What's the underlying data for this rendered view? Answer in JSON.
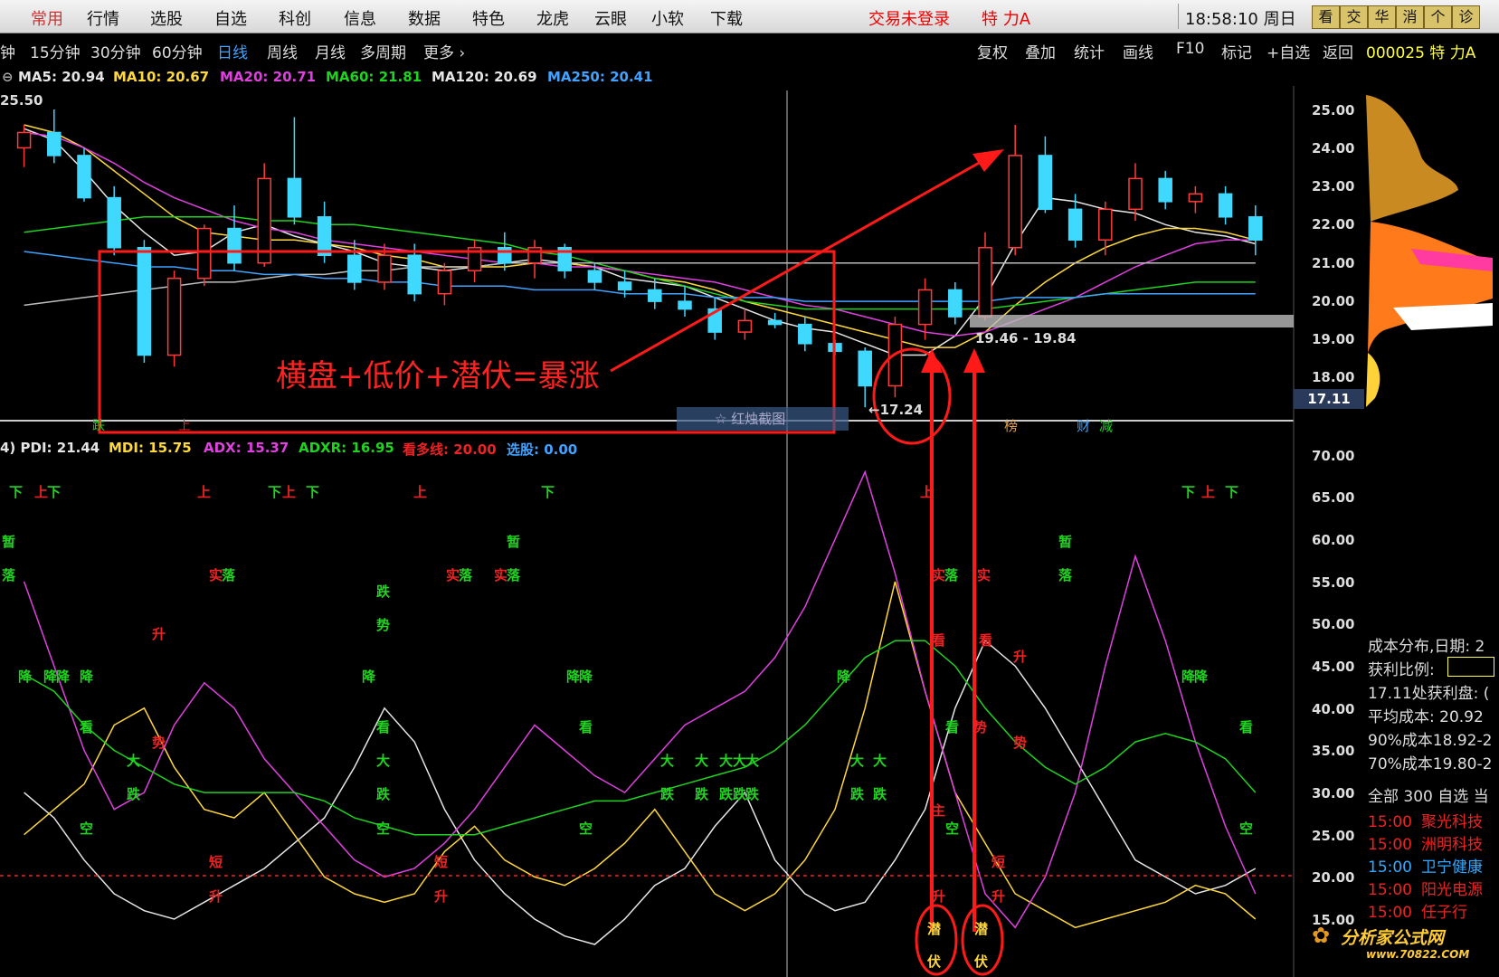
{
  "menu": {
    "items": [
      "常用",
      "行情",
      "选股",
      "自选",
      "科创",
      "信息",
      "数据",
      "特色",
      "龙虎",
      "云眼",
      "小软",
      "下载"
    ],
    "login_status": "交易未登录",
    "stock_name": "特 力A",
    "clock": "18:58:10",
    "weekday": "周日",
    "right_buttons": [
      "看",
      "交",
      "华",
      "消",
      "个",
      "诊"
    ]
  },
  "periods": {
    "items": [
      "钟",
      "15分钟",
      "30分钟",
      "60分钟",
      "日线",
      "周线",
      "月线",
      "多周期",
      "更多"
    ],
    "active": "日线"
  },
  "tools": {
    "items": [
      "复权",
      "叠加",
      "统计",
      "画线",
      "F10",
      "标记",
      "+自选",
      "返回"
    ],
    "stock_label": "000025 特 力A"
  },
  "ma_legend": [
    {
      "label": "MA5: 20.94",
      "color": "#e6e6e6"
    },
    {
      "label": "MA10: 20.67",
      "color": "#ffd83a"
    },
    {
      "label": "MA20: 20.71",
      "color": "#e040e0"
    },
    {
      "label": "MA60: 21.81",
      "color": "#1fd41f"
    },
    {
      "label": "MA120: 20.69",
      "color": "#e6e6e6"
    },
    {
      "label": "MA250: 20.41",
      "color": "#3fa3ff"
    }
  ],
  "price_axis": {
    "top_label": "25.50",
    "ticks": [
      "25.00",
      "24.00",
      "23.00",
      "22.00",
      "21.00",
      "20.00",
      "19.00",
      "18.00"
    ],
    "current": "17.11"
  },
  "chart_annot": {
    "slogan": "横盘+低价+潜伏=暴涨",
    "range_label": "19.46 - 19.84",
    "low_label": "←17.24",
    "watermark": "☆ 红烛截图",
    "event_tags": [
      "跌",
      "上",
      "榜",
      "财",
      "减"
    ]
  },
  "indicator": {
    "legend": [
      {
        "label": "4) PDI: 21.44",
        "color": "#e6e6e6"
      },
      {
        "label": "MDI: 15.75",
        "color": "#ffd83a"
      },
      {
        "label": "ADX: 15.37",
        "color": "#e040e0"
      },
      {
        "label": "ADXR: 16.95",
        "color": "#1fd41f"
      },
      {
        "label": "看多线: 20.00",
        "color": "#ee2222"
      },
      {
        "label": "选股: 0.00",
        "color": "#3fa3ff"
      }
    ],
    "ticks": [
      "70.00",
      "65.00",
      "60.00",
      "55.00",
      "50.00",
      "45.00",
      "40.00",
      "35.00",
      "30.00",
      "25.00",
      "20.00",
      "15.00"
    ],
    "signal_chars": [
      "下",
      "上",
      "暂",
      "落",
      "实",
      "跌",
      "势",
      "降",
      "升",
      "看",
      "大",
      "短",
      "空",
      "主",
      "伏",
      "潜"
    ],
    "latent_1": [
      "潜",
      "伏"
    ],
    "latent_2": [
      "潜",
      "伏"
    ]
  },
  "right_panel": {
    "chips_header": "成本分布,日期: 2",
    "profit_ratio": "获利比例:",
    "profit_at": "17.11处获利盘: (",
    "avg_cost": "平均成本: 20.92",
    "cost90": "90%成本18.92-2",
    "cost70": "70%成本19.80-2",
    "tab_line": "全部 300 自选 当",
    "news": [
      {
        "time": "15:00",
        "name": "聚光科技",
        "blue": false
      },
      {
        "time": "15:00",
        "name": "洲明科技",
        "blue": false
      },
      {
        "time": "15:00",
        "name": "卫宁健康",
        "blue": true
      },
      {
        "time": "15:00",
        "name": "阳光电源",
        "blue": false
      },
      {
        "time": "15:00",
        "name": "任子行",
        "blue": false
      }
    ],
    "logo": "分析家公式网",
    "logo_url": "www.70822.COM"
  },
  "chart_data": {
    "type": "candlestick",
    "series": [
      {
        "name": "MA5",
        "values": [
          24.5,
          24.2,
          23.4,
          22.5,
          21.8,
          21.2,
          21.3,
          21.8,
          22.0,
          21.7,
          21.5,
          21.3,
          21.0,
          20.9,
          20.8,
          20.9,
          21.0,
          21.1,
          21.0,
          20.9,
          20.6,
          20.5,
          20.4,
          20.1,
          19.8,
          19.5,
          19.3,
          19.2,
          18.9,
          18.6,
          18.6,
          19.1,
          20.1,
          21.5,
          22.7,
          22.6,
          22.4,
          22.3,
          22.0,
          21.8,
          21.7,
          21.5
        ]
      },
      {
        "name": "MA10",
        "values": [
          24.6,
          24.4,
          24.0,
          23.4,
          22.8,
          22.2,
          21.8,
          21.7,
          21.6,
          21.6,
          21.5,
          21.4,
          21.2,
          21.1,
          20.9,
          20.9,
          20.9,
          21.0,
          21.0,
          20.9,
          20.8,
          20.6,
          20.5,
          20.3,
          20.0,
          19.8,
          19.6,
          19.4,
          19.2,
          19.0,
          18.8,
          18.8,
          19.2,
          19.9,
          20.5,
          21.0,
          21.4,
          21.7,
          21.9,
          21.9,
          21.8,
          21.6
        ]
      },
      {
        "name": "MA20",
        "values": [
          24.4,
          24.3,
          24.0,
          23.6,
          23.1,
          22.7,
          22.4,
          22.1,
          21.9,
          21.8,
          21.6,
          21.5,
          21.4,
          21.3,
          21.2,
          21.1,
          21.0,
          21.0,
          20.9,
          20.9,
          20.8,
          20.7,
          20.6,
          20.5,
          20.3,
          20.1,
          19.9,
          19.8,
          19.6,
          19.4,
          19.2,
          19.1,
          19.2,
          19.5,
          19.8,
          20.1,
          20.5,
          20.9,
          21.2,
          21.5,
          21.6,
          21.6
        ]
      },
      {
        "name": "MA60",
        "values": [
          21.8,
          21.9,
          22.0,
          22.1,
          22.2,
          22.2,
          22.2,
          22.2,
          22.1,
          22.1,
          22.0,
          22.0,
          21.9,
          21.8,
          21.7,
          21.6,
          21.5,
          21.3,
          21.2,
          21.0,
          20.8,
          20.6,
          20.4,
          20.2,
          20.0,
          19.9,
          19.8,
          19.8,
          19.8,
          19.8,
          19.8,
          19.8,
          19.8,
          19.9,
          20.0,
          20.1,
          20.2,
          20.3,
          20.4,
          20.5,
          20.5,
          20.5
        ]
      },
      {
        "name": "MA120",
        "values": [
          19.9,
          20.0,
          20.1,
          20.2,
          20.3,
          20.4,
          20.5,
          20.5,
          20.6,
          20.7,
          20.7,
          20.8,
          20.8,
          20.9,
          20.9,
          20.9,
          21.0,
          21.0,
          21.0,
          21.0,
          21.0,
          21.0,
          21.0,
          21.0,
          21.0,
          21.0,
          21.0,
          21.0,
          21.0,
          21.0,
          21.0,
          21.0,
          21.0,
          21.0,
          21.0,
          21.0,
          21.0,
          21.0,
          21.0,
          21.0,
          21.0,
          21.0
        ]
      },
      {
        "name": "MA250",
        "values": [
          21.3,
          21.2,
          21.1,
          21.0,
          20.9,
          20.9,
          20.8,
          20.8,
          20.7,
          20.7,
          20.6,
          20.6,
          20.5,
          20.5,
          20.4,
          20.4,
          20.4,
          20.3,
          20.3,
          20.3,
          20.2,
          20.2,
          20.2,
          20.1,
          20.1,
          20.1,
          20.0,
          20.0,
          20.0,
          20.0,
          20.0,
          20.0,
          20.0,
          20.1,
          20.1,
          20.1,
          20.2,
          20.2,
          20.2,
          20.2,
          20.2,
          20.2
        ]
      }
    ],
    "ohlc": [
      [
        24.0,
        24.6,
        23.5,
        24.4
      ],
      [
        24.4,
        25.0,
        23.6,
        23.8
      ],
      [
        23.8,
        24.0,
        22.6,
        22.7
      ],
      [
        22.7,
        23.0,
        21.2,
        21.4
      ],
      [
        21.4,
        21.6,
        18.4,
        18.6
      ],
      [
        18.6,
        20.8,
        18.3,
        20.6
      ],
      [
        20.6,
        22.0,
        20.4,
        21.9
      ],
      [
        21.9,
        22.5,
        20.8,
        21.0
      ],
      [
        21.0,
        23.6,
        20.9,
        23.2
      ],
      [
        23.2,
        24.8,
        22.0,
        22.2
      ],
      [
        22.2,
        22.6,
        21.0,
        21.2
      ],
      [
        21.2,
        21.6,
        20.3,
        20.5
      ],
      [
        20.5,
        21.5,
        20.3,
        21.2
      ],
      [
        21.2,
        21.5,
        20.0,
        20.2
      ],
      [
        20.2,
        21.0,
        19.9,
        20.8
      ],
      [
        20.8,
        21.6,
        20.5,
        21.4
      ],
      [
        21.4,
        21.8,
        20.8,
        21.0
      ],
      [
        21.0,
        21.6,
        20.6,
        21.4
      ],
      [
        21.4,
        21.5,
        20.6,
        20.8
      ],
      [
        20.8,
        21.0,
        20.3,
        20.5
      ],
      [
        20.5,
        20.8,
        20.1,
        20.3
      ],
      [
        20.3,
        20.6,
        19.8,
        20.0
      ],
      [
        20.0,
        20.4,
        19.6,
        19.8
      ],
      [
        19.8,
        20.1,
        19.0,
        19.2
      ],
      [
        19.2,
        19.8,
        19.0,
        19.5
      ],
      [
        19.5,
        19.7,
        19.3,
        19.4
      ],
      [
        19.4,
        19.6,
        18.7,
        18.9
      ],
      [
        18.9,
        19.0,
        18.6,
        18.7
      ],
      [
        18.7,
        18.8,
        17.24,
        17.8
      ],
      [
        17.8,
        19.6,
        17.5,
        19.4
      ],
      [
        19.4,
        20.6,
        19.0,
        20.3
      ],
      [
        20.3,
        20.5,
        19.4,
        19.6
      ],
      [
        19.6,
        21.8,
        19.5,
        21.4
      ],
      [
        21.4,
        24.6,
        21.2,
        23.8
      ],
      [
        23.8,
        24.3,
        22.3,
        22.4
      ],
      [
        22.4,
        22.8,
        21.4,
        21.6
      ],
      [
        21.6,
        22.6,
        21.2,
        22.4
      ],
      [
        22.4,
        23.6,
        22.1,
        23.2
      ],
      [
        23.2,
        23.4,
        22.4,
        22.6
      ],
      [
        22.6,
        23.0,
        22.3,
        22.8
      ],
      [
        22.8,
        23.0,
        22.0,
        22.2
      ],
      [
        22.2,
        22.5,
        21.2,
        21.6
      ]
    ],
    "indicator_series": [
      {
        "name": "PDI",
        "values": [
          30,
          27,
          22,
          18,
          16,
          15,
          17,
          19,
          21,
          24,
          27,
          33,
          40,
          36,
          28,
          22,
          18,
          15,
          13,
          12,
          15,
          19,
          21,
          26,
          30,
          22,
          18,
          16,
          17,
          22,
          28,
          40,
          48,
          45,
          40,
          34,
          28,
          22,
          20,
          18,
          19,
          21
        ]
      },
      {
        "name": "MDI",
        "values": [
          25,
          28,
          31,
          38,
          40,
          33,
          28,
          27,
          30,
          25,
          20,
          18,
          17,
          18,
          23,
          26,
          22,
          20,
          19,
          21,
          24,
          28,
          23,
          18,
          16,
          18,
          22,
          28,
          40,
          55,
          42,
          30,
          24,
          18,
          16,
          14,
          15,
          16,
          17,
          19,
          18,
          15
        ]
      },
      {
        "name": "ADX",
        "values": [
          55,
          45,
          35,
          28,
          30,
          38,
          43,
          40,
          34,
          30,
          26,
          22,
          20,
          21,
          24,
          28,
          33,
          38,
          35,
          32,
          30,
          34,
          38,
          40,
          42,
          46,
          52,
          60,
          68,
          56,
          42,
          30,
          18,
          14,
          20,
          30,
          45,
          58,
          48,
          36,
          26,
          18
        ]
      },
      {
        "name": "ADXR",
        "values": [
          44,
          42,
          38,
          35,
          33,
          31,
          30,
          30,
          30,
          30,
          29,
          27,
          26,
          25,
          25,
          25,
          26,
          27,
          28,
          29,
          29,
          30,
          31,
          32,
          33,
          35,
          38,
          42,
          46,
          48,
          48,
          45,
          40,
          36,
          33,
          31,
          33,
          36,
          37,
          36,
          34,
          30
        ]
      }
    ],
    "ylim": [
      17.0,
      25.5
    ],
    "indicator_ylim": [
      10,
      70
    ],
    "bullish_line": 20.0
  }
}
